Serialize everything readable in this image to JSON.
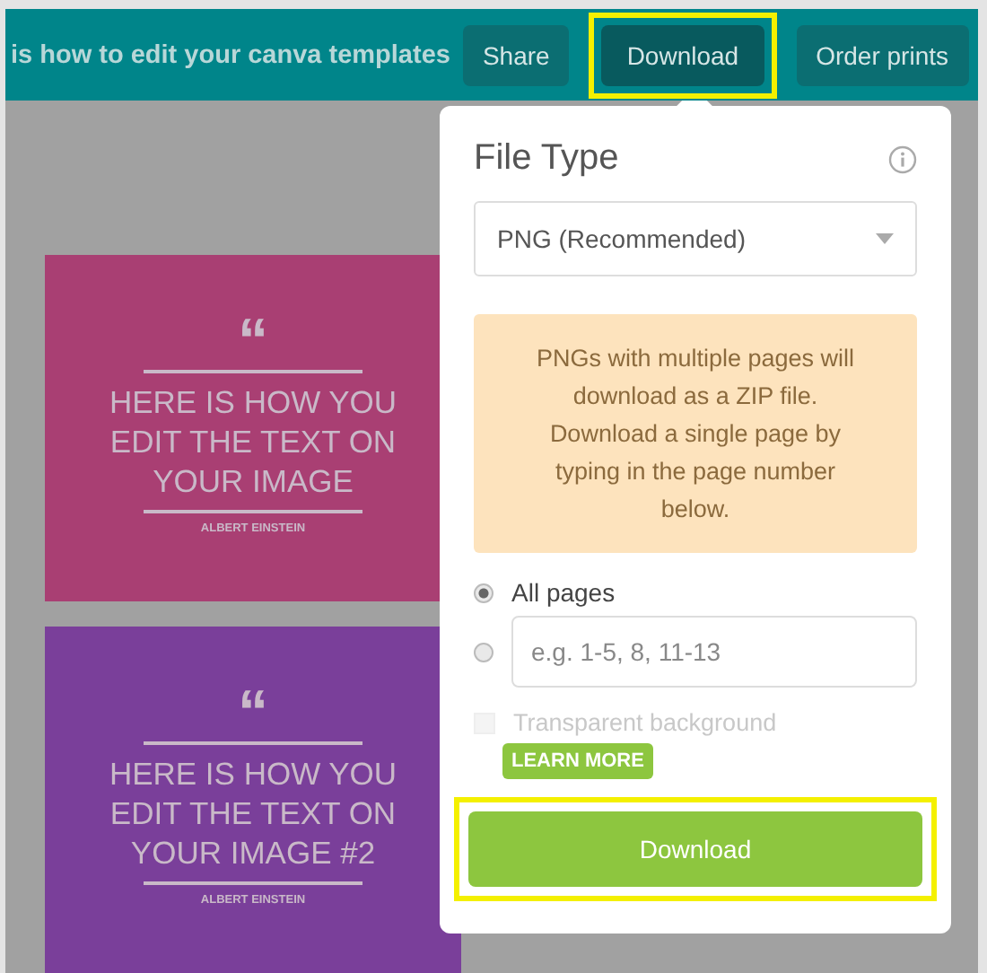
{
  "top_bar": {
    "title": "is how to edit your canva templates",
    "buttons": [
      {
        "label": "Share",
        "highlighted": false
      },
      {
        "label": "Download",
        "highlighted": true
      },
      {
        "label": "Order prints",
        "highlighted": false
      }
    ]
  },
  "cards": [
    {
      "color": "#a93f73",
      "quote_mark": "“",
      "text": "HERE IS HOW YOU EDIT THE TEXT ON YOUR IMAGE",
      "author": "ALBERT EINSTEIN"
    },
    {
      "color": "#7a3f9a",
      "quote_mark": "“",
      "text": "HERE IS HOW YOU EDIT THE TEXT ON YOUR IMAGE #2",
      "author": "ALBERT EINSTEIN"
    }
  ],
  "download_panel": {
    "title": "File Type",
    "file_type": "PNG (Recommended)",
    "notice": "PNGs with multiple pages will download as a ZIP file. Download a single page by typing in the page number below.",
    "page_options": [
      {
        "kind": "label",
        "label": "All pages",
        "selected": true
      },
      {
        "kind": "field",
        "placeholder": "e.g. 1-5, 8, 11-13",
        "selected": false
      }
    ],
    "transparent": {
      "label": "Transparent background",
      "checked": false,
      "disabled": true
    },
    "learn_more": "LEARN MORE",
    "download_button": {
      "label": "Download",
      "highlighted": true
    }
  }
}
